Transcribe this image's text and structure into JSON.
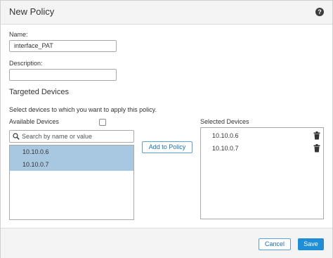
{
  "dialog": {
    "title": "New Policy",
    "help_icon": "?"
  },
  "form": {
    "name_label": "Name:",
    "name_value": "interface_PAT",
    "description_label": "Description:",
    "description_value": ""
  },
  "targeted": {
    "section_title": "Targeted Devices",
    "instruction": "Select devices to which you want to apply this policy.",
    "available_label": "Available Devices",
    "select_all_checked": false,
    "search_placeholder": "Search by name or value",
    "available_devices": [
      {
        "label": "10.10.0.6",
        "selected": true
      },
      {
        "label": "10.10.0.7",
        "selected": true
      }
    ],
    "add_button_label": "Add to Policy",
    "selected_label": "Selected Devices",
    "selected_devices": [
      {
        "label": "10.10.0.6"
      },
      {
        "label": "10.10.0.7"
      }
    ]
  },
  "footer": {
    "cancel_label": "Cancel",
    "save_label": "Save"
  },
  "colors": {
    "selection_highlight": "#a7c8e0",
    "primary_button": "#1e8fd6",
    "link_text": "#1a6fb1"
  }
}
